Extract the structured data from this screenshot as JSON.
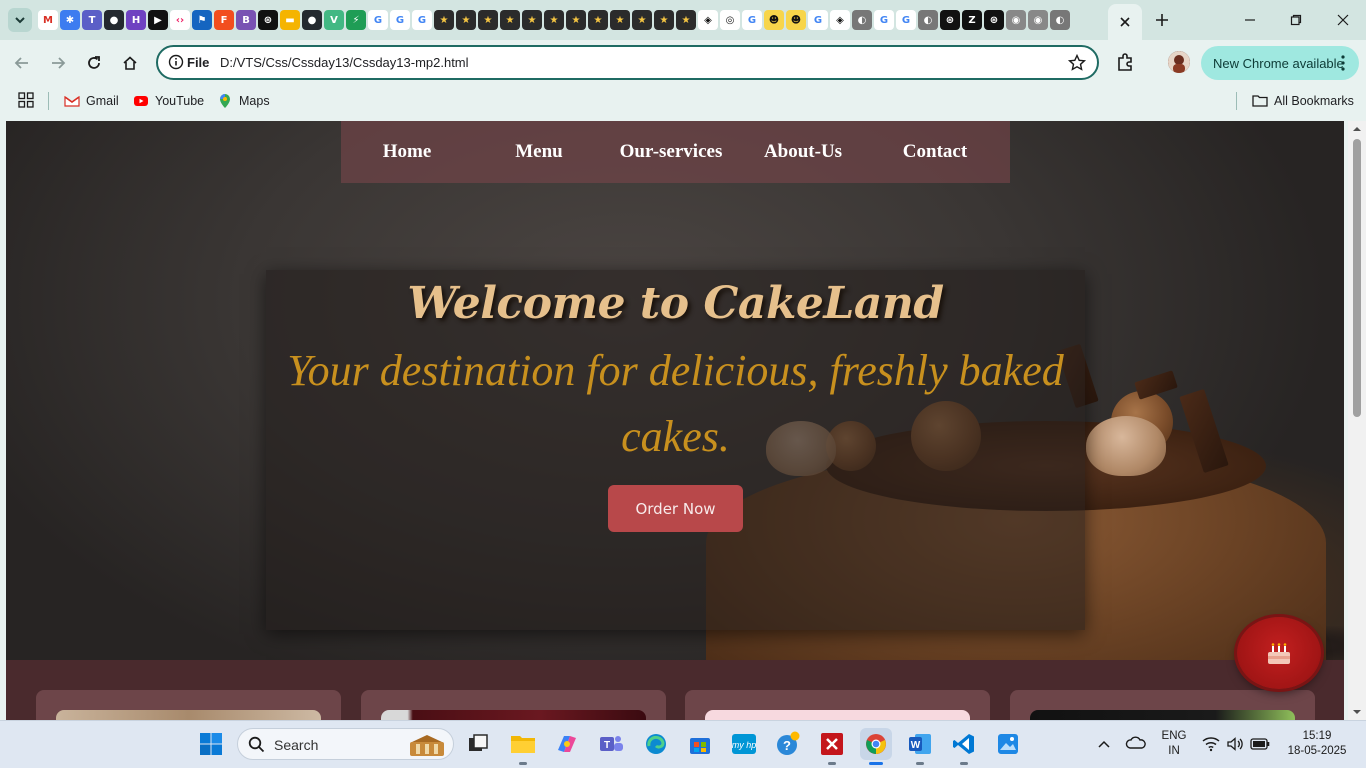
{
  "browser": {
    "url_scheme_label": "File",
    "url": "D:/VTS/Css/Cssday13/Cssday13-mp2.html",
    "update_label": "New Chrome available",
    "bookmarks": [
      {
        "label": "Gmail"
      },
      {
        "label": "YouTube"
      },
      {
        "label": "Maps"
      }
    ],
    "all_bookmarks_label": "All Bookmarks"
  },
  "site": {
    "nav": [
      "Home",
      "Menu",
      "Our-services",
      "About-Us",
      "Contact"
    ],
    "welcome_title": "Welcome to CakeLand",
    "welcome_subtitle": "Your destination for delicious, freshly baked cakes.",
    "order_button": "Order Now"
  },
  "taskbar": {
    "search_placeholder": "Search",
    "language": "ENG",
    "region": "IN",
    "time": "15:19",
    "date": "18-05-2025"
  },
  "colors": {
    "accent": "#1f6b63",
    "nav_bg": "#7a464a",
    "title": "#e6c08c",
    "subtitle": "#c8901e",
    "order_button": "#b8484a"
  }
}
